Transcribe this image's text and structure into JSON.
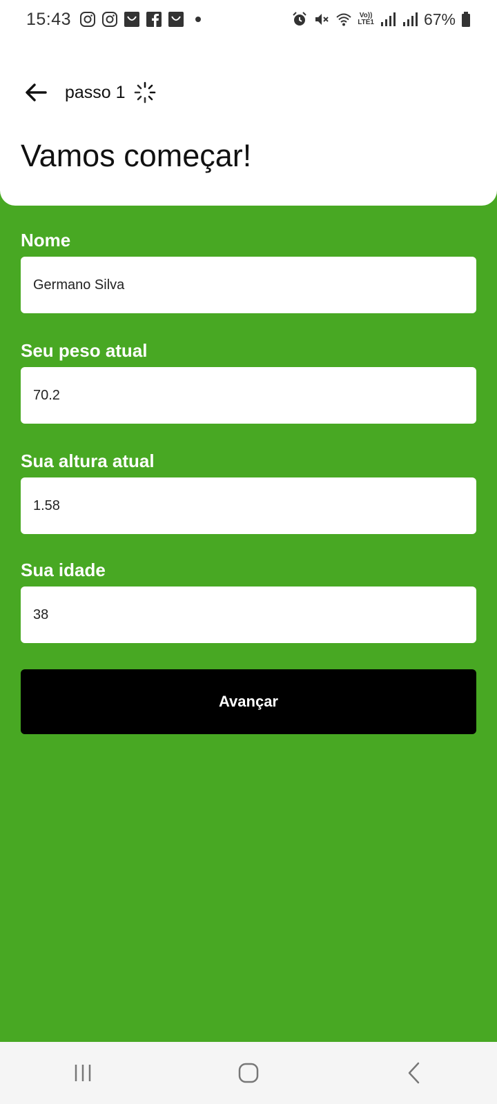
{
  "status_bar": {
    "time": "15:43",
    "battery": "67%",
    "lte_top": "Vo))",
    "lte_bottom": "LTE1",
    "left_icons": [
      "instagram-icon",
      "instagram-icon",
      "shopping-bag-icon",
      "facebook-icon",
      "shopping-bag-icon",
      "dot-icon"
    ],
    "right_icons": [
      "alarm-icon",
      "mute-icon",
      "wifi-icon",
      "signal-icon",
      "signal-icon",
      "battery-icon"
    ]
  },
  "header": {
    "step_label": "passo 1",
    "title": "Vamos começar!"
  },
  "form": {
    "name_label": "Nome",
    "name_value": "Germano Silva",
    "weight_label": "Seu peso atual",
    "weight_value": "70.2",
    "height_label": "Sua altura atual",
    "height_value": "1.58",
    "age_label": "Sua idade",
    "age_value": "38",
    "submit_label": "Avançar"
  },
  "colors": {
    "background": "#48a823",
    "header": "#ffffff",
    "button": "#000000",
    "button_text": "#ffffff"
  }
}
